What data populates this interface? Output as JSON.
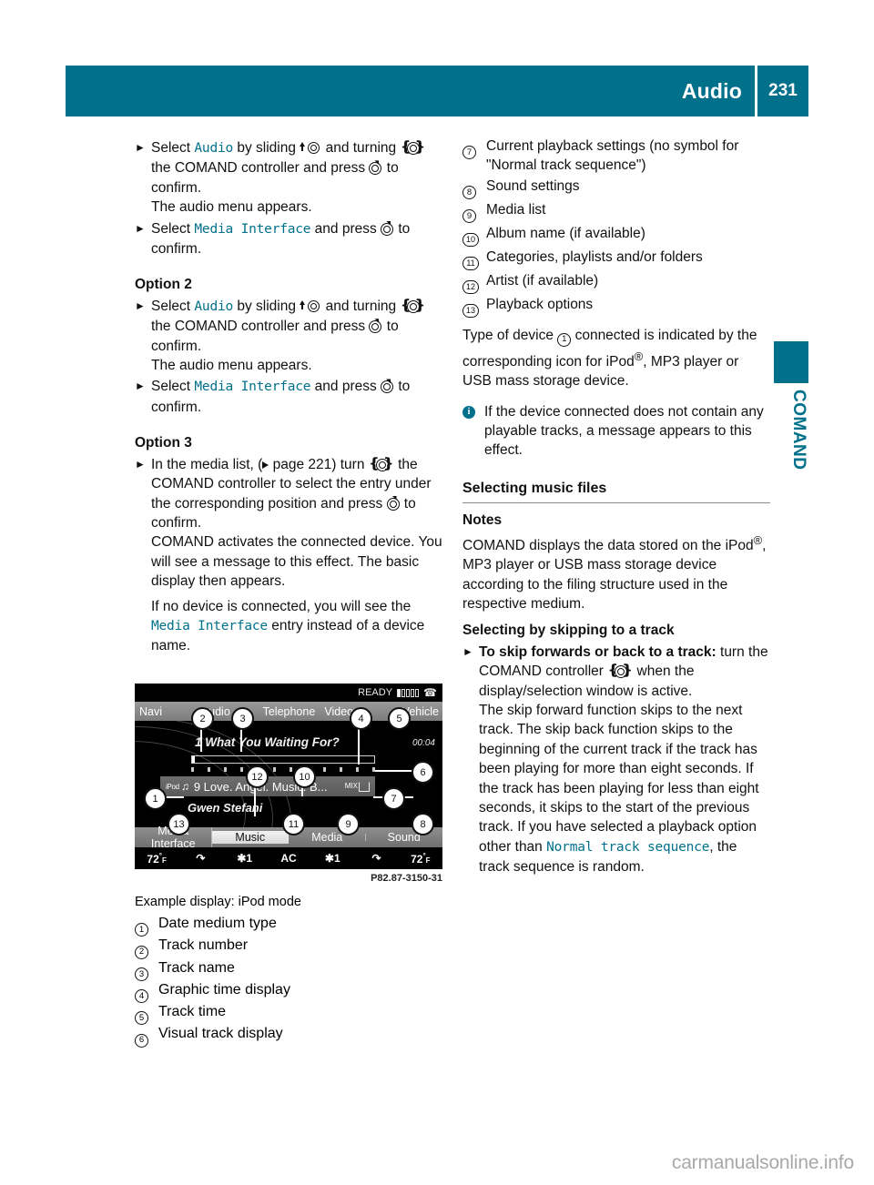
{
  "header": {
    "title": "Audio",
    "page_number": "231",
    "bg_color": "#00708b"
  },
  "thumb_tab": {
    "label": "COMAND",
    "color": "#00708b"
  },
  "left_column": {
    "option1": {
      "step1": {
        "prefix": "Select ",
        "cmd1": "Audio",
        "mid1": " by sliding ",
        "mid2": " and turning ",
        "mid3": " the COMAND controller and press ",
        "mid4": " to confirm.",
        "result": "The audio menu appears."
      },
      "step2": {
        "prefix": "Select ",
        "cmd1": "Media Interface",
        "mid1": " and press ",
        "mid2": " to confirm."
      }
    },
    "option2_heading": "Option 2",
    "option2": {
      "step1": {
        "prefix": "Select ",
        "cmd1": "Audio",
        "mid1": " by sliding ",
        "mid2": " and turning ",
        "mid3": " the COMAND controller and press ",
        "mid4": " to confirm.",
        "result": "The audio menu appears."
      },
      "step2": {
        "prefix": "Select ",
        "cmd1": "Media Interface",
        "mid1": " and press ",
        "mid2": " to confirm."
      }
    },
    "option3_heading": "Option 3",
    "option3": {
      "step1_a": "In the media list, (",
      "step1_pageref": " page 221) turn ",
      "step1_b": " the COMAND controller to select the entry under the corresponding position and press ",
      "step1_c": " to confirm.",
      "para1": "COMAND activates the connected device. You will see a message to this effect. The basic display then appears.",
      "para2_a": "If no device is connected, you will see the ",
      "para2_cmd": "Media Interface",
      "para2_b": " entry instead of a device name."
    }
  },
  "figure": {
    "code": "P82.87-3150-31",
    "caption": "Example display: iPod mode",
    "screen": {
      "status": {
        "ready_text": "READY",
        "signal_bars": [
          true,
          false,
          false,
          false,
          false
        ],
        "phone_icon": "phone-icon"
      },
      "menu_items": [
        "Navi",
        "Audio",
        "Telephone",
        "Video",
        "Vehicle"
      ],
      "track_title": "1 What You Waiting For?",
      "track_time": "00:04",
      "now_playing_device": "iPod",
      "now_playing": "9 Love. Angel. Music. B...",
      "mix_label": "MIX",
      "artist": "Gwen Stefani",
      "soft_keys": [
        "Media Interface",
        "Music",
        "Media",
        "Sound"
      ],
      "active_soft_key": "Music",
      "climate": {
        "left_temp": "72",
        "left_unit": "F",
        "left_fan": "1",
        "center": "AC",
        "right_fan": "1",
        "right_temp": "72",
        "right_unit": "F"
      }
    },
    "callouts": [
      "1",
      "2",
      "3",
      "4",
      "5",
      "6",
      "7",
      "8",
      "9",
      "10",
      "11",
      "12",
      "13"
    ]
  },
  "legend": [
    {
      "num": "1",
      "text": "Date medium type"
    },
    {
      "num": "2",
      "text": "Track number"
    },
    {
      "num": "3",
      "text": "Track name"
    },
    {
      "num": "4",
      "text": "Graphic time display"
    },
    {
      "num": "5",
      "text": "Track time"
    },
    {
      "num": "6",
      "text": "Visual track display"
    },
    {
      "num": "7",
      "text": "Current playback settings (no symbol for \"Normal track sequence\")"
    },
    {
      "num": "8",
      "text": "Sound settings"
    },
    {
      "num": "9",
      "text": "Media list"
    },
    {
      "num": "10",
      "text": "Album name (if available)"
    },
    {
      "num": "11",
      "text": "Categories, playlists and/or folders"
    },
    {
      "num": "12",
      "text": "Artist (if available)"
    },
    {
      "num": "13",
      "text": "Playback options"
    }
  ],
  "right_column": {
    "device_type_a": "Type of device ",
    "device_type_num": "1",
    "device_type_b": " connected is indicated by the corresponding icon for iPod",
    "device_type_sup": "®",
    "device_type_c": ", MP3 player or USB mass storage device.",
    "note": "If the device connected does not contain any playable tracks, a message appears to this effect.",
    "section_heading": "Selecting music files",
    "notes_heading": "Notes",
    "notes_a": "COMAND displays the data stored on the iPod",
    "notes_sup": "®",
    "notes_b": ", MP3 player or USB mass storage device according to the filing structure used in the respective medium.",
    "skip_heading": "Selecting by skipping to a track",
    "skip_step_bold": "To skip forwards or back to a track:",
    "skip_step_a": " turn the COMAND controller ",
    "skip_step_b": " when the display/selection window is active.",
    "skip_para_a": "The skip forward function skips to the next track. The skip back function skips to the beginning of the current track if the track has been playing for more than eight seconds. If the track has been playing for less than eight seconds, it skips to the start of the previous track. If you have selected a playback option other than ",
    "skip_para_cmd": "Normal track sequence",
    "skip_para_b": ", the track sequence is random."
  },
  "watermark": "carmanualsonline.info"
}
